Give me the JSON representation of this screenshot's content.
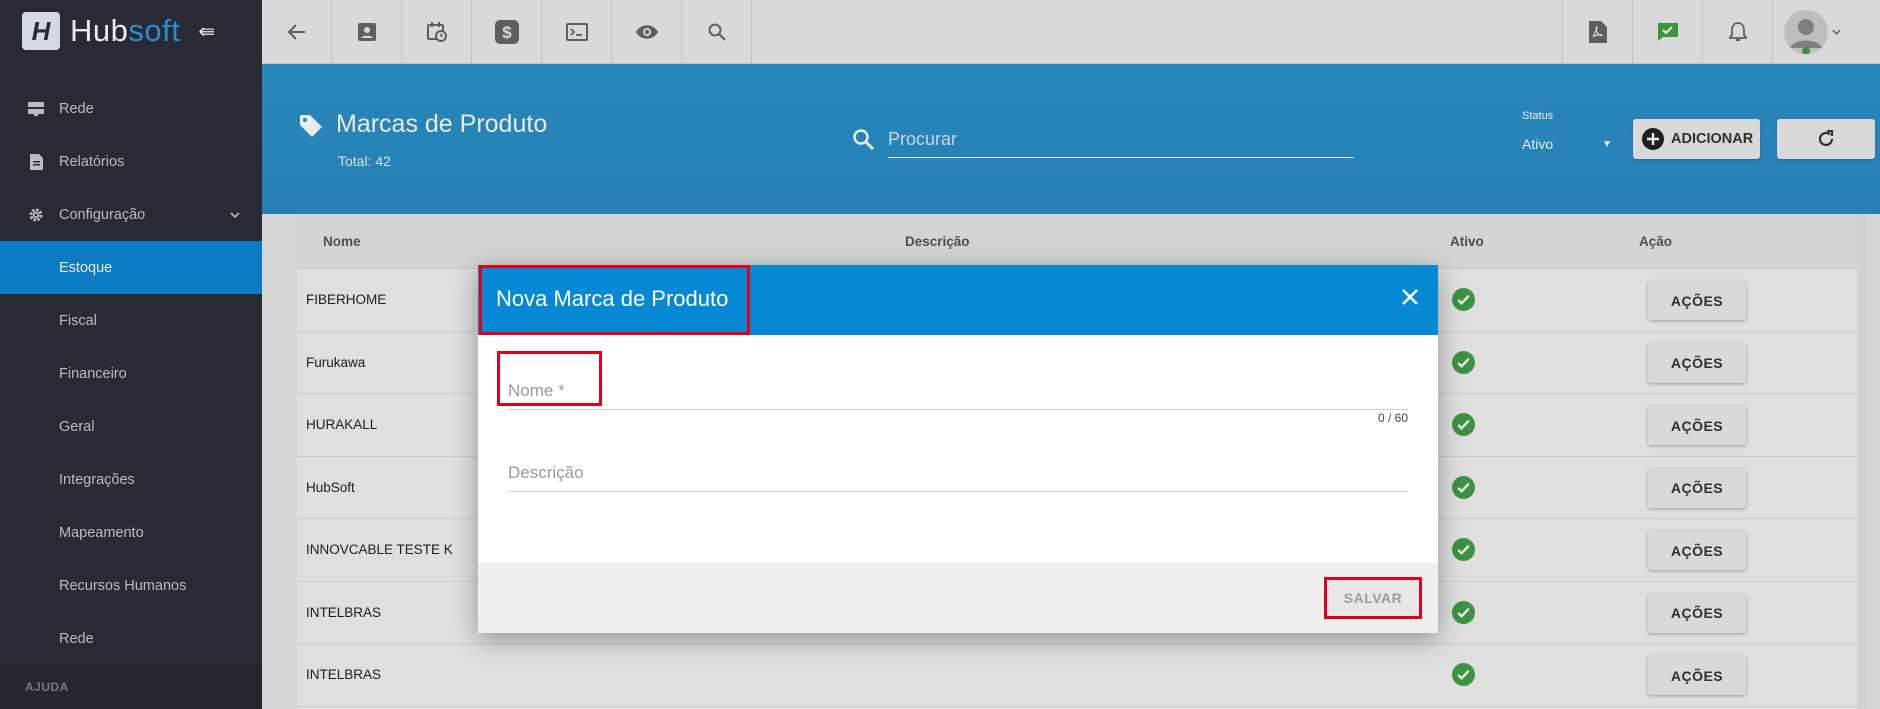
{
  "brand": {
    "part1": "Hub",
    "part2": "soft",
    "logo_letter": "H"
  },
  "sidebar": {
    "items": [
      {
        "label": "Rede",
        "icon": "server-icon"
      },
      {
        "label": "Relatórios",
        "icon": "document-icon"
      },
      {
        "label": "Configuração",
        "icon": "gear-icon"
      }
    ],
    "subitems": [
      {
        "label": "Estoque",
        "active": true
      },
      {
        "label": "Fiscal"
      },
      {
        "label": "Financeiro"
      },
      {
        "label": "Geral"
      },
      {
        "label": "Integrações"
      },
      {
        "label": "Mapeamento"
      },
      {
        "label": "Recursos Humanos"
      },
      {
        "label": "Rede"
      }
    ],
    "section": "AJUDA"
  },
  "toolbar": {
    "left_icons": [
      "back-arrow-icon",
      "contact-card-icon",
      "calendar-clock-icon",
      "dollar-icon",
      "terminal-icon",
      "eye-icon",
      "search-icon"
    ],
    "right_icons": [
      "pdf-icon",
      "chat-check-icon",
      "bell-icon",
      "avatar"
    ]
  },
  "page": {
    "title": "Marcas de Produto",
    "total": "Total: 42",
    "search_placeholder": "Procurar",
    "status_label": "Status",
    "status_value": "Ativo",
    "add_label": "ADICIONAR"
  },
  "table": {
    "headers": {
      "name": "Nome",
      "description": "Descrição",
      "active": "Ativo",
      "action": "Ação"
    },
    "action_label": "AÇÕES",
    "rows": [
      {
        "name": "FIBERHOME"
      },
      {
        "name": "Furukawa"
      },
      {
        "name": "HURAKALL"
      },
      {
        "name": "HubSoft"
      },
      {
        "name": "INNOVCABLE TESTE K"
      },
      {
        "name": "INTELBRAS"
      },
      {
        "name": "INTELBRAS"
      }
    ]
  },
  "modal": {
    "title": "Nova Marca de Produto",
    "name_placeholder": "Nome *",
    "name_counter": "0 / 60",
    "description_placeholder": "Descrição",
    "save_label": "SALVAR"
  },
  "colors": {
    "accent": "#0788d5",
    "sidebar": "#2c2f38",
    "highlight": "#e4001b",
    "success": "#43a047"
  }
}
